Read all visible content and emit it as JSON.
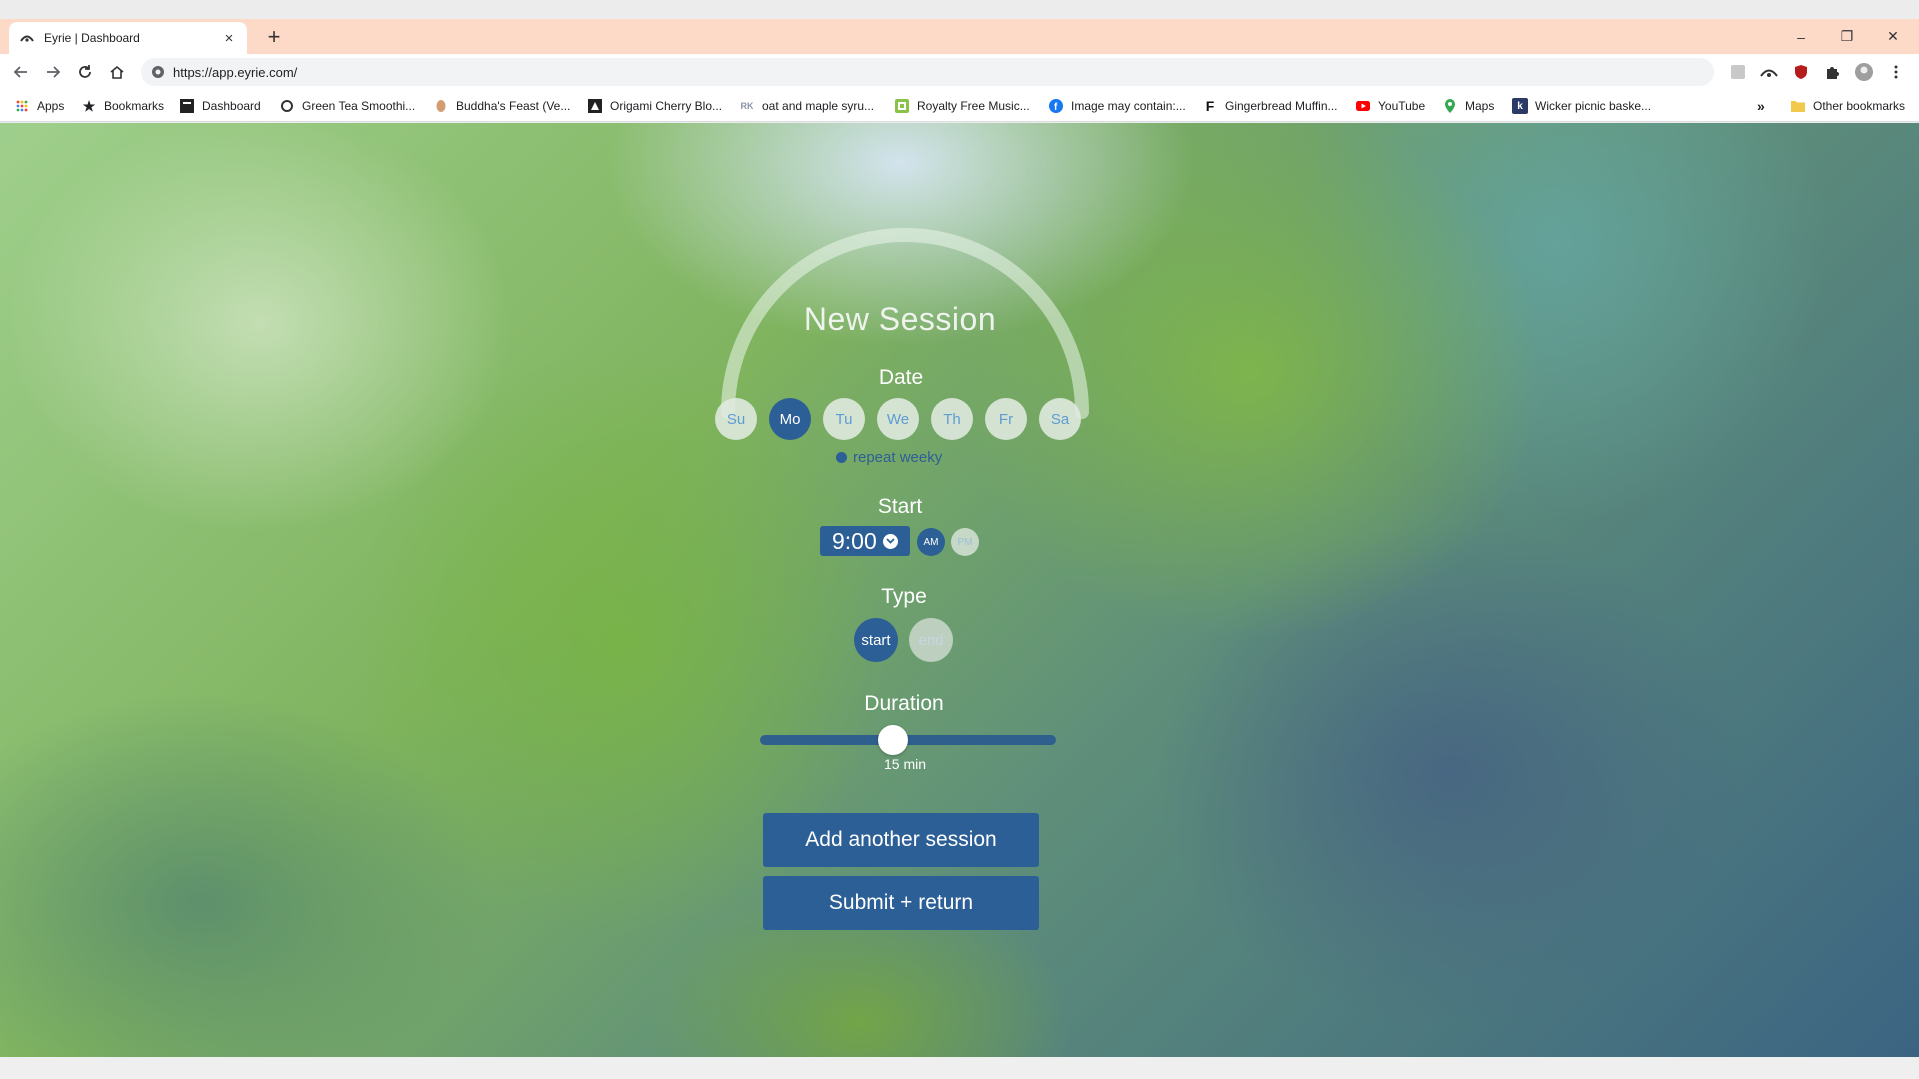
{
  "browser": {
    "tab": {
      "title": "Eyrie | Dashboard",
      "close_glyph": "×"
    },
    "new_tab_glyph": "+",
    "window": {
      "minimize": "–",
      "restore": "❐",
      "close": "✕"
    },
    "address": {
      "url": "https://app.eyrie.com/"
    },
    "bookmarks": [
      {
        "label": "Apps",
        "icon": "apps-grid-icon"
      },
      {
        "label": "Bookmarks",
        "icon": "star-icon"
      },
      {
        "label": "Dashboard",
        "icon": "dashboard-icon"
      },
      {
        "label": "Green Tea Smoothi...",
        "icon": "cup-icon"
      },
      {
        "label": "Buddha's Feast (Ve...",
        "icon": "buddha-icon"
      },
      {
        "label": "Origami Cherry Blo...",
        "icon": "origami-icon"
      },
      {
        "label": "oat and maple syru...",
        "icon": "rk-icon"
      },
      {
        "label": "Royalty Free Music...",
        "icon": "music-b-icon"
      },
      {
        "label": "Image may contain:...",
        "icon": "facebook-icon"
      },
      {
        "label": "Gingerbread Muffin...",
        "icon": "f-icon"
      },
      {
        "label": "YouTube",
        "icon": "youtube-icon"
      },
      {
        "label": "Maps",
        "icon": "maps-pin-icon"
      },
      {
        "label": "Wicker picnic baske...",
        "icon": "k-icon"
      }
    ],
    "overflow_glyph": "»",
    "other_bookmarks": "Other bookmarks"
  },
  "session": {
    "title": "New Session",
    "date_label": "Date",
    "days": [
      {
        "label": "Su",
        "active": false
      },
      {
        "label": "Mo",
        "active": true
      },
      {
        "label": "Tu",
        "active": false
      },
      {
        "label": "We",
        "active": false
      },
      {
        "label": "Th",
        "active": false
      },
      {
        "label": "Fr",
        "active": false
      },
      {
        "label": "Sa",
        "active": false
      }
    ],
    "repeat_label": "repeat weeky",
    "start_label": "Start",
    "start_time": "9:00",
    "am_label": "AM",
    "pm_label": "PM",
    "type_label": "Type",
    "type_start": "start",
    "type_end": "end",
    "duration_label": "Duration",
    "duration_value": "15 min",
    "duration_fraction": 0.45,
    "add_button": "Add another session",
    "submit_button": "Submit + return"
  },
  "colors": {
    "accent": "#2c5f95",
    "tab_bar": "#fdd9c8",
    "day_inactive_bg": "#e1ebe1",
    "day_inactive_text": "#5d9cd3"
  }
}
